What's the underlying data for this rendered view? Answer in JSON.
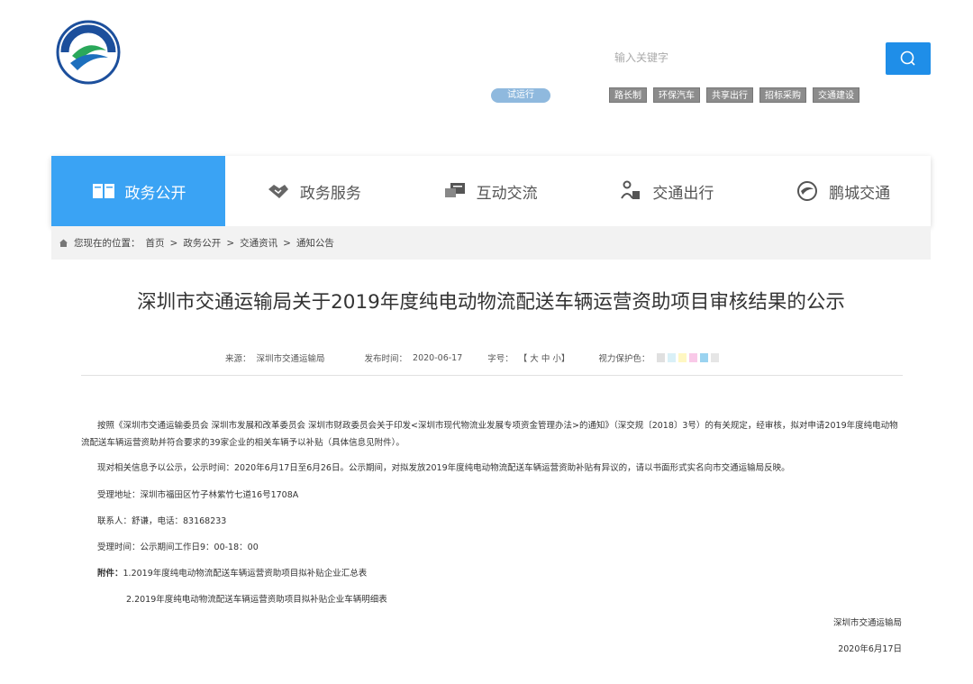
{
  "header": {
    "logo_alt": "深圳市交通运输局",
    "search_placeholder": "输入关键字",
    "trial_badge": "试运行",
    "quick_links": [
      "路长制",
      "环保汽车",
      "共享出行",
      "招标采购",
      "交通建设"
    ]
  },
  "nav": {
    "items": [
      {
        "label": "政务公开",
        "icon": "book-icon"
      },
      {
        "label": "政务服务",
        "icon": "handshake-icon"
      },
      {
        "label": "互动交流",
        "icon": "chat-icon"
      },
      {
        "label": "交通出行",
        "icon": "traveler-icon"
      },
      {
        "label": "鹏城交通",
        "icon": "swirl-logo-icon"
      }
    ]
  },
  "breadcrumb": {
    "prefix": "您现在的位置：",
    "items": [
      "首页",
      "政务公开",
      "交通资讯",
      "通知公告"
    ],
    "separator": ">"
  },
  "article": {
    "title": "深圳市交通运输局关于2019年度纯电动物流配送车辆运营资助项目审核结果的公示",
    "source_label": "来源：",
    "source_value": "深圳市交通运输局",
    "date_label": "发布时间：",
    "date_value": "2020-06-17",
    "font_label": "字号：",
    "font_sizes": "【 大 中 小】",
    "eye_label": "视力保护色：",
    "eye_colors": [
      "#e0e0e0",
      "#d9f0f7",
      "#fff7c2",
      "#f9c9e8",
      "#9ad3f0",
      "#e6e6e6"
    ],
    "p1": "按照《深圳市交通运输委员会 深圳市发展和改革委员会 深圳市财政委员会关于印发<深圳市现代物流业发展专项资金管理办法>的通知》（深交规〔2018〕3号）的有关规定，经审核，拟对申请2019年度纯电动物流配送车辆运营资助并符合要求的39家企业的相关车辆予以补贴（具体信息见附件）。",
    "p2": "现对相关信息予以公示，公示时间：2020年6月17日至6月26日。公示期间，对拟发放2019年度纯电动物流配送车辆运营资助补贴有异议的，请以书面形式实名向市交通运输局反映。",
    "p3": "受理地址：深圳市福田区竹子林紫竹七道16号1708A",
    "p4": "联系人：舒谦，电话：83168233",
    "p5": "受理时间：公示期间工作日9：00-18：00",
    "attachment_label": "附件：",
    "attachment1": "1.2019年度纯电动物流配送车辆运营资助项目拟补贴企业汇总表",
    "attachment2": "2.2019年度纯电动物流配送车辆运营资助项目拟补贴企业车辆明细表",
    "signature": "深圳市交通运输局",
    "sign_date": "2020年6月17日"
  },
  "colors": {
    "accent": "#3aa3f4",
    "search_button": "#1f8ee8",
    "quick_link_bg": "#8c8c8c",
    "trial_badge": "#8fb9de"
  }
}
